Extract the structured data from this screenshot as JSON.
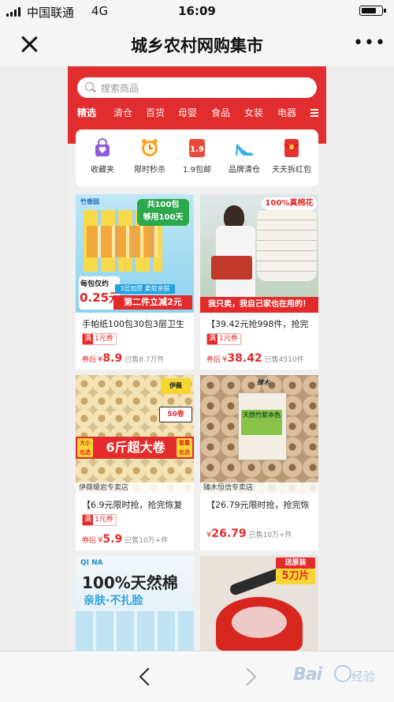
{
  "status_bar": {
    "carrier": "中国联通",
    "network": "4G",
    "time": "16:09",
    "battery_level": 0.8
  },
  "nav": {
    "title": "城乡农村网购集市",
    "close_icon": "close-icon",
    "more_label": "•••"
  },
  "search": {
    "placeholder": "搜索商品"
  },
  "tabs": [
    "精选",
    "清仓",
    "百货",
    "母婴",
    "食品",
    "女装",
    "电器"
  ],
  "categories": [
    {
      "label": "收藏夹",
      "icon": "shopping-bag-icon",
      "color": "#8e5bd6"
    },
    {
      "label": "限时秒杀",
      "icon": "alarm-clock-icon",
      "color": "#f4a623"
    },
    {
      "label": "1.9包邮",
      "icon": "price-tag-icon",
      "color": "#e84b3c"
    },
    {
      "label": "品牌清仓",
      "icon": "high-heel-icon",
      "color": "#3aaee8"
    },
    {
      "label": "天天拆红包",
      "icon": "red-envelope-icon",
      "color": "#e83232"
    }
  ],
  "products": [
    {
      "title": "手帕纸100包30包3层卫生",
      "coupon_label": "满",
      "coupon_value": "1元券",
      "after_label": "券后",
      "currency": "¥",
      "price": "8.9",
      "sold": "已售8.7万件",
      "image_text": {
        "brand": "竹香园",
        "top": "共100包",
        "top2": "够用100天",
        "per": "每包仅约",
        "per_price": "0.25元",
        "layer": "3层加厚 柔软亲肤",
        "promo": "第二件立减2元"
      }
    },
    {
      "title": "【39.42元抢998件，抢完",
      "coupon_label": "满",
      "coupon_value": "1元券",
      "after_label": "券后",
      "currency": "¥",
      "price": "38.42",
      "sold": "已售4510件",
      "image_text": {
        "top": "100%真棉花",
        "banner": "我只卖，我自己家也在用的！"
      }
    },
    {
      "title": "【6.9元限时抢，抢完恢复",
      "coupon_label": "满",
      "coupon_value": "1元券",
      "after_label": "券后",
      "currency": "¥",
      "price": "5.9",
      "sold": "已售10万+件",
      "shop": "伊薇暖岩专卖店",
      "image_text": {
        "brand": "伊薇",
        "count": "50卷",
        "left": "大小\n也选",
        "big": "6斤超大卷",
        "right": "重量\n也选"
      }
    },
    {
      "title": "【26.79元限时抢，抢完恢",
      "currency": "¥",
      "price": "26.79",
      "sold": "已售10万+件",
      "shop": "臻木恒信专卖店",
      "image_text": {
        "brand": "臻木",
        "pack": "天然竹浆本色"
      }
    },
    {
      "image_text": {
        "brand": "QI NA",
        "big1": "100",
        "big2": "%天然棉",
        "sub": "亲肤·不扎脸"
      }
    },
    {
      "image_text": {
        "top": "送原装",
        "big": "5刀片"
      }
    }
  ],
  "bottom_bar": {
    "back_icon": "chevron-left-icon",
    "forward_icon": "chevron-right-icon"
  },
  "watermark": {
    "text1": "Bai",
    "text2": "经验"
  }
}
